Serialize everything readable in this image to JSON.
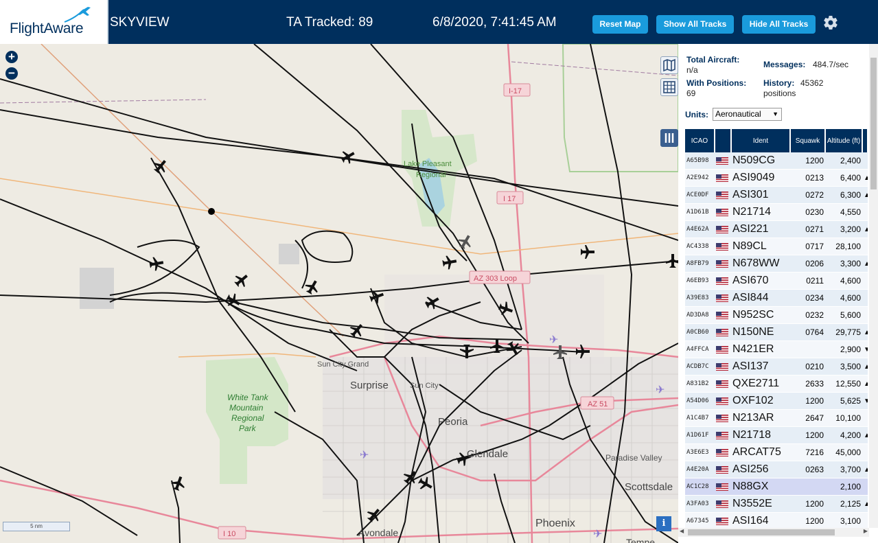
{
  "header": {
    "brand_part1": "Flight",
    "brand_part2": "Aware",
    "app_name": "SKYVIEW",
    "tracked": "TA Tracked: 89",
    "datetime": "6/8/2020, 7:41:45 AM",
    "buttons": {
      "reset": "Reset Map",
      "show_all": "Show All Tracks",
      "hide_all": "Hide All Tracks"
    }
  },
  "stats": {
    "total_aircraft_label": "Total Aircraft:",
    "total_aircraft_value": "n/a",
    "with_positions_label": "With Positions:",
    "with_positions_value": "69",
    "messages_label": "Messages:",
    "messages_value": "484.7/sec",
    "history_label": "History:",
    "history_value": "45362",
    "history_unit": "positions",
    "units_label": "Units:",
    "units_value": "Aeronautical"
  },
  "table": {
    "headers": {
      "icao": "ICAO",
      "ident": "Ident",
      "squawk": "Squawk",
      "altitude": "Altitude (ft)"
    },
    "rows": [
      {
        "icao": "A65B98",
        "ident": "N509CG",
        "squawk": "1200",
        "alt": "2,400",
        "trend": ""
      },
      {
        "icao": "A2E942",
        "ident": "ASI9049",
        "squawk": "0213",
        "alt": "6,400",
        "trend": "▲"
      },
      {
        "icao": "ACE0DF",
        "ident": "ASI301",
        "squawk": "0272",
        "alt": "6,300",
        "trend": "▲"
      },
      {
        "icao": "A1D61B",
        "ident": "N21714",
        "squawk": "0230",
        "alt": "4,550",
        "trend": ""
      },
      {
        "icao": "A4E62A",
        "ident": "ASI221",
        "squawk": "0271",
        "alt": "3,200",
        "trend": "▲"
      },
      {
        "icao": "AC4338",
        "ident": "N89CL",
        "squawk": "0717",
        "alt": "28,100",
        "trend": ""
      },
      {
        "icao": "A8FB79",
        "ident": "N678WW",
        "squawk": "0206",
        "alt": "3,300",
        "trend": "▲"
      },
      {
        "icao": "A6EB93",
        "ident": "ASI670",
        "squawk": "0211",
        "alt": "4,600",
        "trend": ""
      },
      {
        "icao": "A39E83",
        "ident": "ASI844",
        "squawk": "0234",
        "alt": "4,600",
        "trend": ""
      },
      {
        "icao": "AD3DA8",
        "ident": "N952SC",
        "squawk": "0232",
        "alt": "5,600",
        "trend": ""
      },
      {
        "icao": "A0CB60",
        "ident": "N150NE",
        "squawk": "0764",
        "alt": "29,775",
        "trend": "▲"
      },
      {
        "icao": "A4FFCA",
        "ident": "N421ER",
        "squawk": "",
        "alt": "2,900",
        "trend": "▼"
      },
      {
        "icao": "ACDB7C",
        "ident": "ASI137",
        "squawk": "0210",
        "alt": "3,500",
        "trend": "▲"
      },
      {
        "icao": "A831B2",
        "ident": "QXE2711",
        "squawk": "2633",
        "alt": "12,550",
        "trend": "▲"
      },
      {
        "icao": "A54D06",
        "ident": "OXF102",
        "squawk": "1200",
        "alt": "5,625",
        "trend": "▼"
      },
      {
        "icao": "A1C4B7",
        "ident": "N213AR",
        "squawk": "2647",
        "alt": "10,100",
        "trend": ""
      },
      {
        "icao": "A1D61F",
        "ident": "N21718",
        "squawk": "1200",
        "alt": "4,200",
        "trend": "▲"
      },
      {
        "icao": "A3E6E3",
        "ident": "ARCAT75",
        "squawk": "7216",
        "alt": "45,000",
        "trend": ""
      },
      {
        "icao": "A4E20A",
        "ident": "ASI256",
        "squawk": "0263",
        "alt": "3,700",
        "trend": "▲"
      },
      {
        "icao": "AC1C28",
        "ident": "N88GX",
        "squawk": "",
        "alt": "2,100",
        "trend": ""
      },
      {
        "icao": "A3FA03",
        "ident": "N3552E",
        "squawk": "1200",
        "alt": "2,125",
        "trend": "▲"
      },
      {
        "icao": "A67345",
        "ident": "ASI164",
        "squawk": "1200",
        "alt": "3,100",
        "trend": ""
      }
    ]
  },
  "map": {
    "scale_label": "5 nm",
    "labels": {
      "i17_top": "I-17",
      "i17_mid": "I 17",
      "i10": "I 10",
      "az303": "AZ 303 Loop",
      "az51": "AZ 51",
      "lake_pleasant_1": "Lake Pleasant",
      "lake_pleasant_2": "Regional",
      "sun_city_grand": "Sun City Grand",
      "surprise": "Surprise",
      "sun_city": "Sun City",
      "peoria": "Peoria",
      "glendale": "Glendale",
      "paradise_valley": "Paradise Valley",
      "scottsdale": "Scottsdale",
      "phoenix": "Phoenix",
      "avondale": "Avondale",
      "tempe": "Tempe",
      "white_tank_1": "White Tank",
      "white_tank_2": "Mountain",
      "white_tank_3": "Regional",
      "white_tank_4": "Park"
    },
    "info": "i"
  },
  "colors": {
    "navy": "#002f5d",
    "button_blue": "#1a9bdc",
    "map_bg": "#eeebe3",
    "track": "#111111",
    "highway": "#e8879a",
    "park": "#cfe6c3"
  }
}
